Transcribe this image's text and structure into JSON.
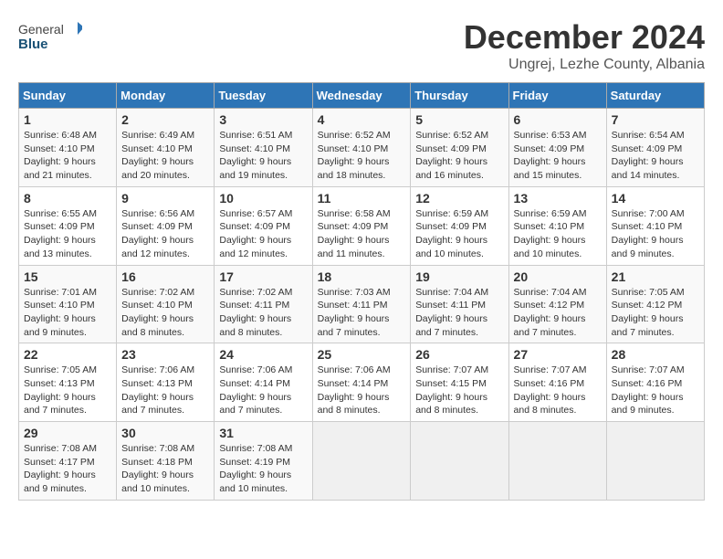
{
  "logo": {
    "general": "General",
    "blue": "Blue"
  },
  "title": "December 2024",
  "subtitle": "Ungrej, Lezhe County, Albania",
  "weekdays": [
    "Sunday",
    "Monday",
    "Tuesday",
    "Wednesday",
    "Thursday",
    "Friday",
    "Saturday"
  ],
  "weeks": [
    [
      {
        "day": "1",
        "sunrise": "6:48 AM",
        "sunset": "4:10 PM",
        "daylight": "9 hours and 21 minutes."
      },
      {
        "day": "2",
        "sunrise": "6:49 AM",
        "sunset": "4:10 PM",
        "daylight": "9 hours and 20 minutes."
      },
      {
        "day": "3",
        "sunrise": "6:51 AM",
        "sunset": "4:10 PM",
        "daylight": "9 hours and 19 minutes."
      },
      {
        "day": "4",
        "sunrise": "6:52 AM",
        "sunset": "4:10 PM",
        "daylight": "9 hours and 18 minutes."
      },
      {
        "day": "5",
        "sunrise": "6:52 AM",
        "sunset": "4:09 PM",
        "daylight": "9 hours and 16 minutes."
      },
      {
        "day": "6",
        "sunrise": "6:53 AM",
        "sunset": "4:09 PM",
        "daylight": "9 hours and 15 minutes."
      },
      {
        "day": "7",
        "sunrise": "6:54 AM",
        "sunset": "4:09 PM",
        "daylight": "9 hours and 14 minutes."
      }
    ],
    [
      {
        "day": "8",
        "sunrise": "6:55 AM",
        "sunset": "4:09 PM",
        "daylight": "9 hours and 13 minutes."
      },
      {
        "day": "9",
        "sunrise": "6:56 AM",
        "sunset": "4:09 PM",
        "daylight": "9 hours and 12 minutes."
      },
      {
        "day": "10",
        "sunrise": "6:57 AM",
        "sunset": "4:09 PM",
        "daylight": "9 hours and 12 minutes."
      },
      {
        "day": "11",
        "sunrise": "6:58 AM",
        "sunset": "4:09 PM",
        "daylight": "9 hours and 11 minutes."
      },
      {
        "day": "12",
        "sunrise": "6:59 AM",
        "sunset": "4:09 PM",
        "daylight": "9 hours and 10 minutes."
      },
      {
        "day": "13",
        "sunrise": "6:59 AM",
        "sunset": "4:10 PM",
        "daylight": "9 hours and 10 minutes."
      },
      {
        "day": "14",
        "sunrise": "7:00 AM",
        "sunset": "4:10 PM",
        "daylight": "9 hours and 9 minutes."
      }
    ],
    [
      {
        "day": "15",
        "sunrise": "7:01 AM",
        "sunset": "4:10 PM",
        "daylight": "9 hours and 9 minutes."
      },
      {
        "day": "16",
        "sunrise": "7:02 AM",
        "sunset": "4:10 PM",
        "daylight": "9 hours and 8 minutes."
      },
      {
        "day": "17",
        "sunrise": "7:02 AM",
        "sunset": "4:11 PM",
        "daylight": "9 hours and 8 minutes."
      },
      {
        "day": "18",
        "sunrise": "7:03 AM",
        "sunset": "4:11 PM",
        "daylight": "9 hours and 7 minutes."
      },
      {
        "day": "19",
        "sunrise": "7:04 AM",
        "sunset": "4:11 PM",
        "daylight": "9 hours and 7 minutes."
      },
      {
        "day": "20",
        "sunrise": "7:04 AM",
        "sunset": "4:12 PM",
        "daylight": "9 hours and 7 minutes."
      },
      {
        "day": "21",
        "sunrise": "7:05 AM",
        "sunset": "4:12 PM",
        "daylight": "9 hours and 7 minutes."
      }
    ],
    [
      {
        "day": "22",
        "sunrise": "7:05 AM",
        "sunset": "4:13 PM",
        "daylight": "9 hours and 7 minutes."
      },
      {
        "day": "23",
        "sunrise": "7:06 AM",
        "sunset": "4:13 PM",
        "daylight": "9 hours and 7 minutes."
      },
      {
        "day": "24",
        "sunrise": "7:06 AM",
        "sunset": "4:14 PM",
        "daylight": "9 hours and 7 minutes."
      },
      {
        "day": "25",
        "sunrise": "7:06 AM",
        "sunset": "4:14 PM",
        "daylight": "9 hours and 8 minutes."
      },
      {
        "day": "26",
        "sunrise": "7:07 AM",
        "sunset": "4:15 PM",
        "daylight": "9 hours and 8 minutes."
      },
      {
        "day": "27",
        "sunrise": "7:07 AM",
        "sunset": "4:16 PM",
        "daylight": "9 hours and 8 minutes."
      },
      {
        "day": "28",
        "sunrise": "7:07 AM",
        "sunset": "4:16 PM",
        "daylight": "9 hours and 9 minutes."
      }
    ],
    [
      {
        "day": "29",
        "sunrise": "7:08 AM",
        "sunset": "4:17 PM",
        "daylight": "9 hours and 9 minutes."
      },
      {
        "day": "30",
        "sunrise": "7:08 AM",
        "sunset": "4:18 PM",
        "daylight": "9 hours and 10 minutes."
      },
      {
        "day": "31",
        "sunrise": "7:08 AM",
        "sunset": "4:19 PM",
        "daylight": "9 hours and 10 minutes."
      },
      null,
      null,
      null,
      null
    ]
  ]
}
